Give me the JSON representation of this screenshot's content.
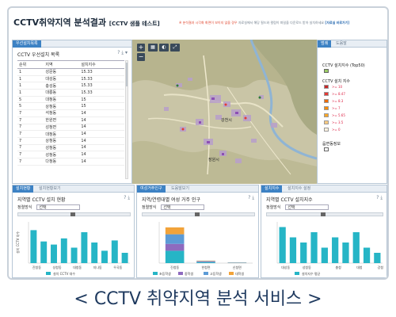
{
  "header": {
    "title": "CCTV취약지역 분석결과",
    "subtitle": "[CCTV 샘플 테스트]",
    "notice_warn": "※ 분석결과 시각화 화면이 보이지 않을 경우",
    "notice_body": "자료실에서 해당 필드와 컬럼이 파일을 다운로드 받아 실치하세요",
    "notice_link": "[자료실 바로가기]"
  },
  "left_panel": {
    "tab": "우선설치목록",
    "title": "CCTV 우선설치 목록",
    "columns": [
      "순위",
      "지역",
      "설치지수"
    ],
    "rows": [
      [
        "1",
        "성문동",
        "15.33"
      ],
      [
        "1",
        "대성동",
        "15.33"
      ],
      [
        "1",
        "충성동",
        "15.33"
      ],
      [
        "1",
        "대룡동",
        "15.33"
      ],
      [
        "5",
        "대청동",
        "15"
      ],
      [
        "5",
        "상청동",
        "15"
      ],
      [
        "7",
        "석청동",
        "14"
      ],
      [
        "7",
        "한원면",
        "14"
      ],
      [
        "7",
        "성청면",
        "14"
      ],
      [
        "7",
        "대청동",
        "14"
      ],
      [
        "7",
        "상청동",
        "14"
      ],
      [
        "7",
        "성청동",
        "14"
      ],
      [
        "7",
        "성청동",
        "14"
      ],
      [
        "7",
        "다청동",
        "14"
      ]
    ]
  },
  "map": {
    "zoom_in": "+",
    "zoom_out": "−",
    "labels": [
      "강천시",
      "장원시"
    ]
  },
  "legend": {
    "tab": "범례",
    "tab2": "도움말",
    "top50_title": "CCTV 설치지수 (Top50)",
    "index_title": "CCTV 설치 지수",
    "items": [
      {
        "label": ">= 10",
        "color": "#c62828"
      },
      {
        "label": ">= 8.47",
        "color": "#e53935"
      },
      {
        "label": ">= 8.3",
        "color": "#ef6c00"
      },
      {
        "label": ">= 7",
        "color": "#fb8c00"
      },
      {
        "label": ">= 5.65",
        "color": "#ffa726"
      },
      {
        "label": ">= 3.5",
        "color": "#ffcc80"
      },
      {
        "label": ">= 0",
        "color": "#fff3e0"
      }
    ],
    "area_title": "읍면동정보",
    "top50_color": "#9ccc65"
  },
  "bottom_panels": [
    {
      "tab": "설치현황",
      "tab2": "설치현황보기",
      "title": "지역별 CCTV 설치 현황",
      "select_label": "정렬방식",
      "select_value": "선택",
      "legend_label": "설치 CCTV 대수",
      "bar_color": "#26b5c6",
      "ylabel": "설치 CCTV 대수"
    },
    {
      "tab": "여성거주인구",
      "tab2": "도움말보기",
      "title": "지역/연령대별 여성 거주 인구",
      "select_label": "정렬방식",
      "select_value": "선택",
      "legend_items": [
        {
          "label": "초등학생",
          "color": "#26b5c6"
        },
        {
          "label": "중학생",
          "color": "#8e6bbf"
        },
        {
          "label": "고등학생",
          "color": "#5c9bd6"
        },
        {
          "label": "대학생",
          "color": "#f2a33a"
        }
      ]
    },
    {
      "tab": "설치지수",
      "tab2": "설치지수 설정",
      "title": "지역별 CCTV 설치지수",
      "select_label": "정렬방식",
      "select_value": "선택",
      "legend_label": "설치지수 평균",
      "bar_color": "#26b5c6"
    }
  ],
  "chart_data": [
    {
      "type": "bar",
      "title": "지역별 CCTV 설치 현황",
      "ylabel": "설치 CCTV 대수",
      "categories": [
        "진청동",
        "",
        "성청동",
        "",
        "대청동",
        "",
        "지나동",
        "",
        "우곡동",
        ""
      ],
      "values": [
        3.2,
        2.1,
        1.8,
        2.4,
        1.5,
        3.0,
        2.0,
        1.2,
        2.2,
        1.0
      ],
      "ylim": [
        0,
        4
      ]
    },
    {
      "type": "bar",
      "title": "지역/연령대별 여성 거주 인구",
      "categories": [
        "진청동",
        "한청면",
        "신청면"
      ],
      "series": [
        {
          "name": "초등학생",
          "values": [
            900,
            60,
            20
          ]
        },
        {
          "name": "중학생",
          "values": [
            500,
            40,
            10
          ]
        },
        {
          "name": "고등학생",
          "values": [
            700,
            50,
            15
          ]
        },
        {
          "name": "대학생",
          "values": [
            500,
            30,
            10
          ]
        }
      ],
      "ylim": [
        0,
        3000
      ]
    },
    {
      "type": "bar",
      "title": "지역별 CCTV 설치지수",
      "categories": [
        "대성동",
        "",
        "성청동",
        "",
        "",
        "충청",
        "",
        "대청",
        "",
        "강청"
      ],
      "values": [
        7,
        5,
        4,
        6,
        3,
        5,
        4,
        6,
        3,
        2
      ],
      "ylim": [
        0,
        8
      ]
    }
  ],
  "banner": {
    "text": "< CCTV 취약지역 분석 서비스 >"
  }
}
